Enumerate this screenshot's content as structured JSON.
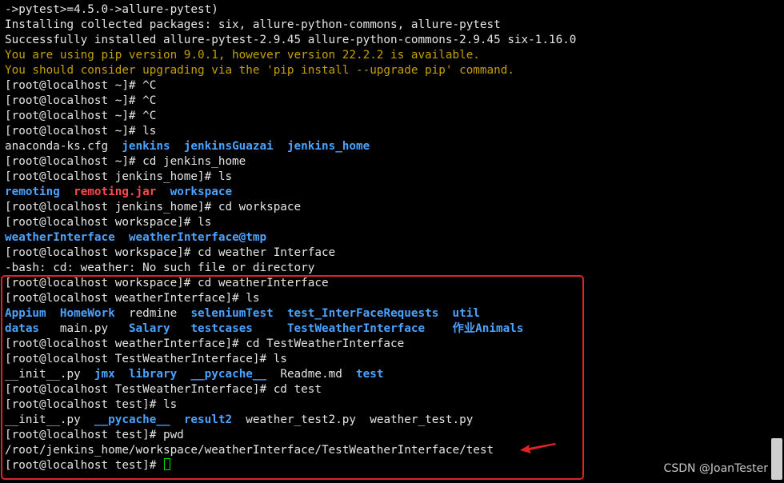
{
  "terminal": {
    "lines": [
      [
        {
          "t": "->pytest>=4.5.0->allure-pytest)",
          "c": "plain"
        }
      ],
      [
        {
          "t": "Installing collected packages: six, allure-python-commons, allure-pytest",
          "c": "plain"
        }
      ],
      [
        {
          "t": "Successfully installed allure-pytest-2.9.45 allure-python-commons-2.9.45 six-1.16.0",
          "c": "plain"
        }
      ],
      [
        {
          "t": "You are using pip version 9.0.1, however version 22.2.2 is available.",
          "c": "yellow"
        }
      ],
      [
        {
          "t": "You should consider upgrading via the 'pip install --upgrade pip' command.",
          "c": "yellow"
        }
      ],
      [
        {
          "t": "[root@localhost ~]# ^C",
          "c": "plain"
        }
      ],
      [
        {
          "t": "[root@localhost ~]# ^C",
          "c": "plain"
        }
      ],
      [
        {
          "t": "[root@localhost ~]# ^C",
          "c": "plain"
        }
      ],
      [
        {
          "t": "[root@localhost ~]# ls",
          "c": "plain"
        }
      ],
      [
        {
          "t": "anaconda-ks.cfg  ",
          "c": "plain"
        },
        {
          "t": "jenkins",
          "c": "dir"
        },
        {
          "t": "  ",
          "c": "plain"
        },
        {
          "t": "jenkinsGuazai",
          "c": "dir"
        },
        {
          "t": "  ",
          "c": "plain"
        },
        {
          "t": "jenkins_home",
          "c": "dir"
        }
      ],
      [
        {
          "t": "[root@localhost ~]# cd jenkins_home",
          "c": "plain"
        }
      ],
      [
        {
          "t": "[root@localhost jenkins_home]# ls",
          "c": "plain"
        }
      ],
      [
        {
          "t": "remoting",
          "c": "dir"
        },
        {
          "t": "  ",
          "c": "plain"
        },
        {
          "t": "remoting.jar",
          "c": "red"
        },
        {
          "t": "  ",
          "c": "plain"
        },
        {
          "t": "workspace",
          "c": "dir"
        }
      ],
      [
        {
          "t": "[root@localhost jenkins_home]# cd workspace",
          "c": "plain"
        }
      ],
      [
        {
          "t": "[root@localhost workspace]# ls",
          "c": "plain"
        }
      ],
      [
        {
          "t": "weatherInterface",
          "c": "dir"
        },
        {
          "t": "  ",
          "c": "plain"
        },
        {
          "t": "weatherInterface@tmp",
          "c": "dir"
        }
      ],
      [
        {
          "t": "[root@localhost workspace]# cd weather Interface",
          "c": "plain"
        }
      ],
      [
        {
          "t": "-bash: cd: weather: No such file or directory",
          "c": "plain"
        }
      ],
      [
        {
          "t": "[root@localhost workspace]# cd weatherInterface",
          "c": "plain"
        }
      ],
      [
        {
          "t": "[root@localhost weatherInterface]# ls",
          "c": "plain"
        }
      ],
      [
        {
          "t": "Appium",
          "c": "dir"
        },
        {
          "t": "  ",
          "c": "plain"
        },
        {
          "t": "HomeWork",
          "c": "dir"
        },
        {
          "t": "  redmine  ",
          "c": "plain"
        },
        {
          "t": "seleniumTest",
          "c": "dir"
        },
        {
          "t": "  ",
          "c": "plain"
        },
        {
          "t": "test_InterFaceRequests",
          "c": "dir"
        },
        {
          "t": "  ",
          "c": "plain"
        },
        {
          "t": "util",
          "c": "dir"
        }
      ],
      [
        {
          "t": "datas",
          "c": "dir"
        },
        {
          "t": "   main.py   ",
          "c": "plain"
        },
        {
          "t": "Salary",
          "c": "dir"
        },
        {
          "t": "   ",
          "c": "plain"
        },
        {
          "t": "testcases",
          "c": "dir"
        },
        {
          "t": "     ",
          "c": "plain"
        },
        {
          "t": "TestWeatherInterface",
          "c": "dir"
        },
        {
          "t": "    ",
          "c": "plain"
        },
        {
          "t": "作业Animals",
          "c": "dir"
        }
      ],
      [
        {
          "t": "[root@localhost weatherInterface]# cd TestWeatherInterface",
          "c": "plain"
        }
      ],
      [
        {
          "t": "[root@localhost TestWeatherInterface]# ls",
          "c": "plain"
        }
      ],
      [
        {
          "t": "__init__.py  ",
          "c": "plain"
        },
        {
          "t": "jmx",
          "c": "dir"
        },
        {
          "t": "  ",
          "c": "plain"
        },
        {
          "t": "library",
          "c": "dir"
        },
        {
          "t": "  ",
          "c": "plain"
        },
        {
          "t": "__pycache__",
          "c": "dir"
        },
        {
          "t": "  Readme.md  ",
          "c": "plain"
        },
        {
          "t": "test",
          "c": "dir"
        }
      ],
      [
        {
          "t": "[root@localhost TestWeatherInterface]# cd test",
          "c": "plain"
        }
      ],
      [
        {
          "t": "[root@localhost test]# ls",
          "c": "plain"
        }
      ],
      [
        {
          "t": "__init__.py  ",
          "c": "plain"
        },
        {
          "t": "__pycache__",
          "c": "dir"
        },
        {
          "t": "  ",
          "c": "plain"
        },
        {
          "t": "result2",
          "c": "dir"
        },
        {
          "t": "  weather_test2.py  weather_test.py",
          "c": "plain"
        }
      ],
      [
        {
          "t": "[root@localhost test]# pwd",
          "c": "plain"
        }
      ],
      [
        {
          "t": "/root/jenkins_home/workspace/weatherInterface/TestWeatherInterface/test",
          "c": "plain"
        }
      ],
      [
        {
          "t": "[root@localhost test]# ",
          "c": "plain"
        }
      ]
    ]
  },
  "colors": {
    "background": "#000000",
    "text": "#e5e5e5",
    "warning": "#c4a000",
    "directory": "#4aa3ff",
    "archive": "#ff4a4a",
    "highlight_border": "#e02424",
    "cursor": "#00e000"
  },
  "watermark": "CSDN @JoanTester"
}
